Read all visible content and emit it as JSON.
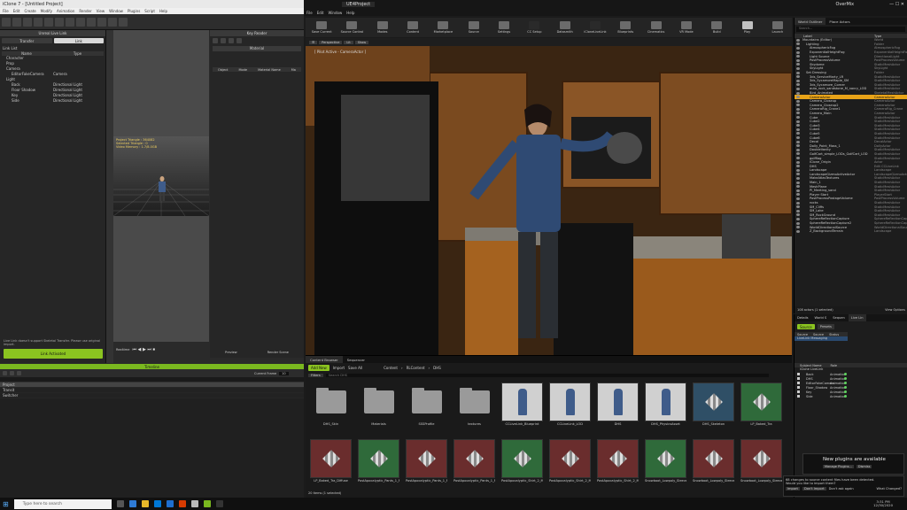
{
  "left_app": {
    "title": "iClone 7 - [Untitled Project]",
    "menus": [
      "File",
      "Edit",
      "Create",
      "Modify",
      "Animation",
      "Render",
      "View",
      "Window",
      "Plugins",
      "Script",
      "Help"
    ],
    "livelink_panel": {
      "header": "Unreal Live Link",
      "tabs": [
        "Transfer",
        "Link"
      ],
      "section_label": "Link List",
      "columns": [
        "Name",
        "Type"
      ],
      "rows": [
        {
          "name": "Character",
          "type": ""
        },
        {
          "name": "Prop",
          "type": ""
        },
        {
          "name": "Camera",
          "type": ""
        },
        {
          "name": "EditorFakeCamera",
          "type": "Camera"
        },
        {
          "name": "Light",
          "type": ""
        },
        {
          "name": "Back",
          "type": "Directional Light"
        },
        {
          "name": "Floor Shadow",
          "type": "Directional Light"
        },
        {
          "name": "Key",
          "type": "Directional Light"
        },
        {
          "name": "Side",
          "type": "Directional Light"
        }
      ],
      "footer_note": "Live Link doesn't support Skeletal Transfer. Please use original import.",
      "link_button": "Link Activated"
    },
    "viewport_info": {
      "line1": "Project Triangle : 364082",
      "line2": "Selected Triangle : 0",
      "line3": "Video Memory : 1.7/8.0GB"
    },
    "key_editor": {
      "header": "Key Reader",
      "subheader": "Material",
      "columns": [
        "Object",
        "Mode",
        "Material Name",
        "Ma"
      ]
    },
    "timeline_header": "Timeline",
    "timeline_rows": [
      "Project",
      "Transit",
      "Switcher"
    ],
    "transport": {
      "realtime": "Realtime",
      "preview": "Preview",
      "render": "Render Scene"
    },
    "frame_field": "Current Frame",
    "frame_value": "10"
  },
  "right_app": {
    "title": "UE4Project",
    "menus": [
      "File",
      "Edit",
      "Window",
      "Help"
    ],
    "window_label": "OverMix",
    "toolbar": [
      "Save Current",
      "Source Control",
      "Modes",
      "Content",
      "Marketplace",
      "Source",
      "Settings",
      "CC Setup",
      "Datasmith",
      "iCloneLiveLink",
      "Blueprints",
      "Cinematics",
      "VR Mode",
      "Build",
      "Play",
      "Launch"
    ],
    "viewport": {
      "perspective": "Perspective",
      "lit": "Lit",
      "show": "Show",
      "pilot": "[ Pilot Active - CameraActor ]"
    },
    "outliner": {
      "tabs": [
        "World Outliner",
        "Place Actors"
      ],
      "search_placeholder": "Search...",
      "columns": [
        "Label",
        "Type"
      ],
      "rows": [
        {
          "label": "Mountains (Editor)",
          "type": "World"
        },
        {
          "label": "Lighting",
          "type": "Folder"
        },
        {
          "label": "AtmosphericFog",
          "type": "AtmosphericFog"
        },
        {
          "label": "ExponentialHeightFog",
          "type": "ExponentialHeightFog"
        },
        {
          "label": "Light Source",
          "type": "DirectionalLight"
        },
        {
          "label": "PostProcessVolume",
          "type": "PostProcessVolume"
        },
        {
          "label": "Skydome",
          "type": "StaticMeshActor"
        },
        {
          "label": "SkyLight",
          "type": "SkyLight"
        },
        {
          "label": "Set Dressing",
          "type": "Folder"
        },
        {
          "label": "3ds_ServiceMarty_LR",
          "type": "StaticMeshActor"
        },
        {
          "label": "3ds_SycamoreMaple_SM",
          "type": "StaticMeshActor"
        },
        {
          "label": "3ds_Sycamore_Corner",
          "type": "StaticMeshActor"
        },
        {
          "label": "auto_rock_sandstone_M_nanry_LOD",
          "type": "StaticMeshActor"
        },
        {
          "label": "Bird_Animated",
          "type": "SkeletalMeshActor"
        },
        {
          "label": "CameraActor",
          "type": "CameraActor"
        },
        {
          "label": "Camera_Closeup",
          "type": "CameraActor"
        },
        {
          "label": "Camera_Closeup2",
          "type": "CameraActor"
        },
        {
          "label": "CameraRig_Crane1",
          "type": "CameraRig_Crane"
        },
        {
          "label": "Camera_Main",
          "type": "CameraActor"
        },
        {
          "label": "Cube",
          "type": "StaticMeshActor"
        },
        {
          "label": "Cube2",
          "type": "StaticMeshActor"
        },
        {
          "label": "Cube3",
          "type": "StaticMeshActor"
        },
        {
          "label": "Cube4",
          "type": "StaticMeshActor"
        },
        {
          "label": "Cube5",
          "type": "StaticMeshActor"
        },
        {
          "label": "Cube6",
          "type": "StaticMeshActor"
        },
        {
          "label": "Decal",
          "type": "DecalActor"
        },
        {
          "label": "Dolly_Point_Mass_1",
          "type": "DollyActor"
        },
        {
          "label": "DoubleVanity",
          "type": "StaticMeshActor"
        },
        {
          "label": "GolfCart_simple_LODs_GolfCart_LOD",
          "type": "StaticMeshActor"
        },
        {
          "label": "golfflag",
          "type": "StaticMeshActor"
        },
        {
          "label": "iClone_Origin",
          "type": "Actor"
        },
        {
          "label": "DHS",
          "type": "Edit CCLiveLink"
        },
        {
          "label": "Landscape",
          "type": "Landscape"
        },
        {
          "label": "LandscapeGizmoActiveActor",
          "type": "LandscapeGizmoActor"
        },
        {
          "label": "MakeAtlasTextures",
          "type": "StaticMeshActor"
        },
        {
          "label": "Main_1",
          "type": "StaticMeshActor"
        },
        {
          "label": "MeshPlane",
          "type": "StaticMeshActor"
        },
        {
          "label": "Pi_Meeting_sand",
          "type": "StaticMeshActor"
        },
        {
          "label": "Player Start",
          "type": "PlayerStart"
        },
        {
          "label": "PostProcessPostageVolume",
          "type": "PostProcessVolume"
        },
        {
          "label": "rocks",
          "type": "StaticMeshActor"
        },
        {
          "label": "SM_Cliffs",
          "type": "StaticMeshActor"
        },
        {
          "label": "SM_Lake",
          "type": "StaticMeshActor"
        },
        {
          "label": "SM_RockGround",
          "type": "StaticMeshActor"
        },
        {
          "label": "SphereReflectionCapture",
          "type": "SphereReflectionCapture"
        },
        {
          "label": "SphereReflectionCapture2",
          "type": "SphereReflectionCapture"
        },
        {
          "label": "WorldDirectionalSource",
          "type": "WorldDirectionalSource"
        },
        {
          "label": "Z_BackgroundTerrain",
          "type": "Landscape"
        }
      ],
      "footer": "108 actors (1 selected)",
      "view_options": "View Options"
    },
    "details": {
      "tabs": [
        "Details",
        "World S",
        "Sequen",
        "Live Lin"
      ],
      "source_button": "Source",
      "presets_button": "Presets",
      "source_columns": [
        "Source",
        "Source",
        "Status"
      ],
      "source_row": "LiveLink Messaging",
      "subject_columns": [
        "Subject Name",
        "Role"
      ],
      "subject_group": "iClone LiveLink",
      "subjects": [
        {
          "name": "Back",
          "role": "Animation"
        },
        {
          "name": "DHS",
          "role": "Animation"
        },
        {
          "name": "EditorFakeCamera",
          "role": "Animation"
        },
        {
          "name": "Floor_Shadow",
          "role": "Animation"
        },
        {
          "name": "Key",
          "role": "Animation"
        },
        {
          "name": "Side",
          "role": "Animation"
        }
      ]
    },
    "content_browser": {
      "tabs": [
        "Content Browser",
        "Sequencer"
      ],
      "add_new": "Add New",
      "import": "Import",
      "save_all": "Save All",
      "path": [
        "Content",
        "RLContent",
        "DHS"
      ],
      "filters": "Filters",
      "search_placeholder": "Search DHS",
      "row1": [
        {
          "label": "DHS_Skin",
          "kind": "folder"
        },
        {
          "label": "Materials",
          "kind": "folder"
        },
        {
          "label": "SSSProfile",
          "kind": "folder"
        },
        {
          "label": "textures",
          "kind": "folder"
        },
        {
          "label": "CCLiveLink_Blueprint",
          "kind": "character"
        },
        {
          "label": "CCLiveLink_LOD",
          "kind": "character"
        },
        {
          "label": "DHS",
          "kind": "character"
        },
        {
          "label": "DHS_PhysicsAsset",
          "kind": "character"
        },
        {
          "label": "DHS_Skeleton",
          "kind": "skeleton"
        },
        {
          "label": "LP_Baked_Tra",
          "kind": "texture"
        }
      ],
      "row2": [
        {
          "label": "LP_Baked_Tra_Diffuse",
          "kind": "material"
        },
        {
          "label": "PostApocalyptic_Pants_1_MAT_Sty",
          "kind": "texture"
        },
        {
          "label": "PostApocalyptic_Pants_1_MAT_Sty_Diffuse",
          "kind": "material"
        },
        {
          "label": "PostApocalyptic_Pants_1_MAT_Sty_Normal",
          "kind": "material"
        },
        {
          "label": "PostApocalyptic_Shirt_2_MAT_Sty",
          "kind": "texture"
        },
        {
          "label": "PostApocalyptic_Shirt_2_MAT_Sty_Diffuse",
          "kind": "material"
        },
        {
          "label": "PostApocalyptic_Shirt_2_MAT_Sty_Normal",
          "kind": "material"
        },
        {
          "label": "Snowboot_Lowpoly_Sleeved_Baked_Tra",
          "kind": "texture"
        },
        {
          "label": "Snowboot_Lowpoly_Sleeved_Baked_Tra_Diffuse",
          "kind": "material"
        },
        {
          "label": "Snowboot_Lowpoly_Sleeved_Baked_Tra_Normal",
          "kind": "material"
        }
      ],
      "footer": "20 items (1 selected)"
    },
    "notification": {
      "title": "New plugins are available",
      "manage": "Manage Plugins...",
      "dismiss": "Dismiss"
    },
    "source_toast": {
      "line1": "68 changes to source content files have been detected.",
      "line2": "Would you like to import them?",
      "import": "Import",
      "dont_import": "Don't Import",
      "ask": "Don't ask again",
      "what": "What Changed?"
    }
  },
  "taskbar": {
    "search_placeholder": "Type here to search",
    "time": "3:31 PM",
    "date": "12/30/2020"
  },
  "colors": {
    "accent_green": "#8bc420",
    "ue_select": "#e8a318"
  }
}
